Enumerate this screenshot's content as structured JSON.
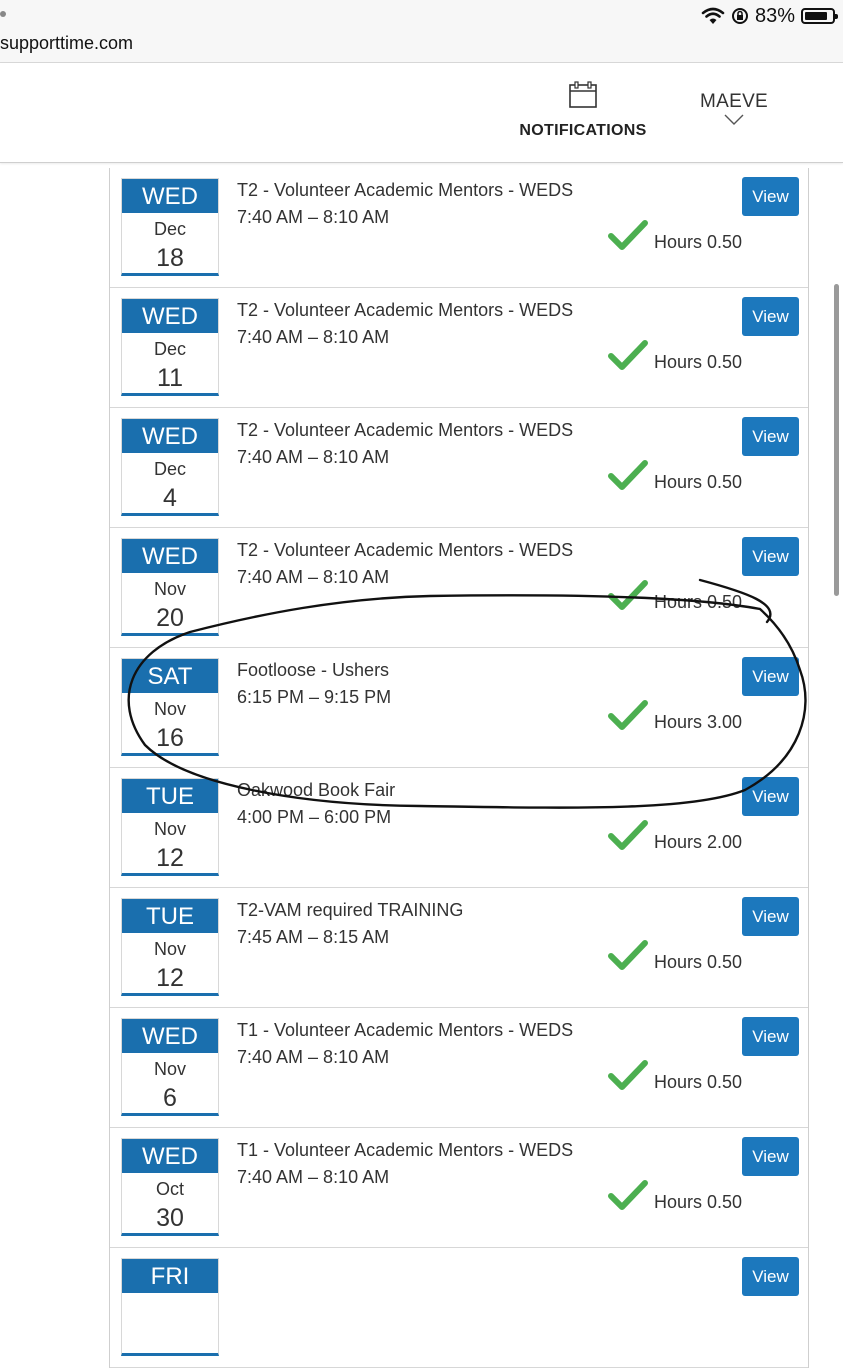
{
  "browser": {
    "url": "supporttime.com",
    "battery_percent": "83%",
    "battery_level": 0.83
  },
  "header": {
    "notifications_label": "NOTIFICATIONS",
    "user_name": "MAEVE"
  },
  "colors": {
    "date_header": "#1a6fae",
    "view_button": "#1c78bd",
    "check": "#4caf50",
    "annotation": "#111111"
  },
  "icons": [
    "wifi-icon",
    "orientation-lock-icon",
    "battery-icon",
    "calendar-icon",
    "chevron-down-icon",
    "checkmark-icon"
  ],
  "entries": [
    {
      "dow": "WED",
      "month": "Dec",
      "day": "18",
      "title": "T2 - Volunteer Academic Mentors - WEDS",
      "time": "7:40 AM – 8:10 AM",
      "hours": "Hours 0.50",
      "view": "View"
    },
    {
      "dow": "WED",
      "month": "Dec",
      "day": "11",
      "title": "T2 - Volunteer Academic Mentors - WEDS",
      "time": "7:40 AM – 8:10 AM",
      "hours": "Hours 0.50",
      "view": "View"
    },
    {
      "dow": "WED",
      "month": "Dec",
      "day": "4",
      "title": "T2 - Volunteer Academic Mentors - WEDS",
      "time": "7:40 AM – 8:10 AM",
      "hours": "Hours 0.50",
      "view": "View"
    },
    {
      "dow": "WED",
      "month": "Nov",
      "day": "20",
      "title": "T2 - Volunteer Academic Mentors - WEDS",
      "time": "7:40 AM – 8:10 AM",
      "hours": "Hours 0.50",
      "view": "View"
    },
    {
      "dow": "SAT",
      "month": "Nov",
      "day": "16",
      "title": "Footloose - Ushers",
      "time": "6:15 PM – 9:15 PM",
      "hours": "Hours 3.00",
      "view": "View"
    },
    {
      "dow": "TUE",
      "month": "Nov",
      "day": "12",
      "title": "Oakwood Book Fair",
      "time": "4:00 PM – 6:00 PM",
      "hours": "Hours 2.00",
      "view": "View"
    },
    {
      "dow": "TUE",
      "month": "Nov",
      "day": "12",
      "title": "T2-VAM required TRAINING",
      "time": "7:45 AM – 8:15 AM",
      "hours": "Hours 0.50",
      "view": "View"
    },
    {
      "dow": "WED",
      "month": "Nov",
      "day": "6",
      "title": "T1 - Volunteer Academic Mentors - WEDS",
      "time": "7:40 AM – 8:10 AM",
      "hours": "Hours 0.50",
      "view": "View"
    },
    {
      "dow": "WED",
      "month": "Oct",
      "day": "30",
      "title": "T1 - Volunteer Academic Mentors - WEDS",
      "time": "7:40 AM – 8:10 AM",
      "hours": "Hours 0.50",
      "view": "View"
    },
    {
      "dow": "FRI",
      "month": "",
      "day": "",
      "title": "",
      "time": "",
      "hours": "",
      "view": "View",
      "partial": true
    }
  ]
}
